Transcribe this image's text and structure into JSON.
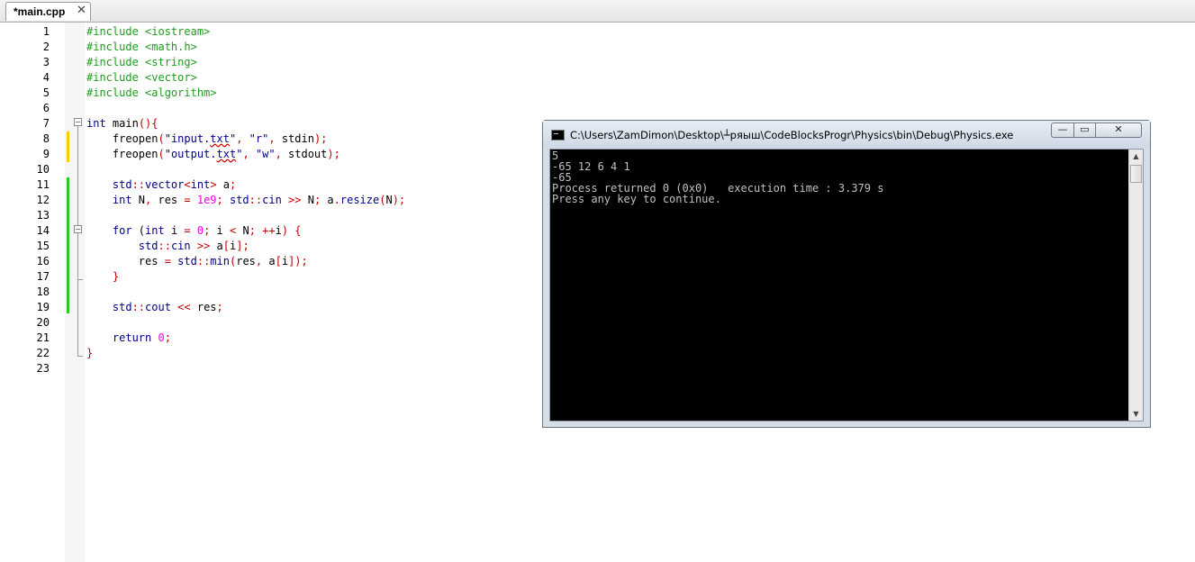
{
  "tab": {
    "title": "*main.cpp",
    "close_glyph": "✕"
  },
  "editor": {
    "line_numbers": [
      "1",
      "2",
      "3",
      "4",
      "5",
      "6",
      "7",
      "8",
      "9",
      "10",
      "11",
      "12",
      "13",
      "14",
      "15",
      "16",
      "17",
      "18",
      "19",
      "20",
      "21",
      "22",
      "23"
    ],
    "lines": [
      [
        {
          "t": "#include <iostream>",
          "c": "pp"
        }
      ],
      [
        {
          "t": "#include <math.h>",
          "c": "pp"
        }
      ],
      [
        {
          "t": "#include <string>",
          "c": "pp"
        }
      ],
      [
        {
          "t": "#include <vector>",
          "c": "pp"
        }
      ],
      [
        {
          "t": "#include <algorithm>",
          "c": "pp"
        }
      ],
      [],
      [
        {
          "t": "int",
          "c": "kw"
        },
        {
          "t": " main"
        },
        {
          "t": "(){",
          "c": "op"
        }
      ],
      [
        {
          "t": "    freopen"
        },
        {
          "t": "(",
          "c": "op"
        },
        {
          "t": "\"input.",
          "c": "str"
        },
        {
          "t": "txt",
          "c": "str sq"
        },
        {
          "t": "\"",
          "c": "str"
        },
        {
          "t": ", ",
          "c": "op"
        },
        {
          "t": "\"r\"",
          "c": "str"
        },
        {
          "t": ", ",
          "c": "op"
        },
        {
          "t": "stdin"
        },
        {
          "t": ");",
          "c": "op"
        }
      ],
      [
        {
          "t": "    freopen"
        },
        {
          "t": "(",
          "c": "op"
        },
        {
          "t": "\"output.",
          "c": "str"
        },
        {
          "t": "txt",
          "c": "str sq"
        },
        {
          "t": "\"",
          "c": "str"
        },
        {
          "t": ", ",
          "c": "op"
        },
        {
          "t": "\"w\"",
          "c": "str"
        },
        {
          "t": ", ",
          "c": "op"
        },
        {
          "t": "stdout"
        },
        {
          "t": ");",
          "c": "op"
        }
      ],
      [],
      [
        {
          "t": "    std",
          "c": "kw"
        },
        {
          "t": "::",
          "c": "op"
        },
        {
          "t": "vector",
          "c": "kw"
        },
        {
          "t": "<",
          "c": "op"
        },
        {
          "t": "int",
          "c": "kw"
        },
        {
          "t": ">",
          "c": "op"
        },
        {
          "t": " a"
        },
        {
          "t": ";",
          "c": "op"
        }
      ],
      [
        {
          "t": "    int",
          "c": "kw"
        },
        {
          "t": " N"
        },
        {
          "t": ", ",
          "c": "op"
        },
        {
          "t": "res "
        },
        {
          "t": "= ",
          "c": "op"
        },
        {
          "t": "1e9",
          "c": "num"
        },
        {
          "t": "; ",
          "c": "op"
        },
        {
          "t": "std",
          "c": "kw"
        },
        {
          "t": "::",
          "c": "op"
        },
        {
          "t": "cin",
          "c": "kw"
        },
        {
          "t": " >> ",
          "c": "op"
        },
        {
          "t": "N"
        },
        {
          "t": "; ",
          "c": "op"
        },
        {
          "t": "a"
        },
        {
          "t": ".",
          "c": "op"
        },
        {
          "t": "resize",
          "c": "kw"
        },
        {
          "t": "(",
          "c": "op"
        },
        {
          "t": "N"
        },
        {
          "t": ");",
          "c": "op"
        }
      ],
      [],
      [
        {
          "t": "    for",
          "c": "kw"
        },
        {
          "t": " ("
        },
        {
          "t": "int",
          "c": "kw"
        },
        {
          "t": " i "
        },
        {
          "t": "= ",
          "c": "op"
        },
        {
          "t": "0",
          "c": "num"
        },
        {
          "t": "; ",
          "c": "op"
        },
        {
          "t": "i "
        },
        {
          "t": "< ",
          "c": "op"
        },
        {
          "t": "N"
        },
        {
          "t": "; ++",
          "c": "op"
        },
        {
          "t": "i"
        },
        {
          "t": ") {",
          "c": "op"
        }
      ],
      [
        {
          "t": "        std",
          "c": "kw"
        },
        {
          "t": "::",
          "c": "op"
        },
        {
          "t": "cin",
          "c": "kw"
        },
        {
          "t": " >> ",
          "c": "op"
        },
        {
          "t": "a"
        },
        {
          "t": "[",
          "c": "op"
        },
        {
          "t": "i"
        },
        {
          "t": "];",
          "c": "op"
        }
      ],
      [
        {
          "t": "        res "
        },
        {
          "t": "= ",
          "c": "op"
        },
        {
          "t": "std",
          "c": "kw"
        },
        {
          "t": "::",
          "c": "op"
        },
        {
          "t": "min",
          "c": "kw"
        },
        {
          "t": "(",
          "c": "op"
        },
        {
          "t": "res"
        },
        {
          "t": ", ",
          "c": "op"
        },
        {
          "t": "a"
        },
        {
          "t": "[",
          "c": "op"
        },
        {
          "t": "i"
        },
        {
          "t": "]);",
          "c": "op"
        }
      ],
      [
        {
          "t": "    }",
          "c": "op"
        }
      ],
      [],
      [
        {
          "t": "    std",
          "c": "kw"
        },
        {
          "t": "::",
          "c": "op"
        },
        {
          "t": "cout",
          "c": "kw"
        },
        {
          "t": " << ",
          "c": "op"
        },
        {
          "t": "res"
        },
        {
          "t": ";",
          "c": "op"
        }
      ],
      [],
      [
        {
          "t": "    return",
          "c": "kw"
        },
        {
          "t": " "
        },
        {
          "t": "0",
          "c": "num"
        },
        {
          "t": ";",
          "c": "op"
        }
      ],
      [
        {
          "t": "}",
          "c": "op"
        }
      ],
      []
    ]
  },
  "console": {
    "title": "C:\\Users\\ZamDimon\\Desktop\\┴ряыш\\CodeBlocksProgr\\Physics\\bin\\Debug\\Physics.exe",
    "buttons": {
      "minimize": "—",
      "maximize": "▭",
      "close": "✕"
    },
    "output": [
      "5",
      "-65 12 6 4 1",
      "-65",
      "Process returned 0 (0x0)   execution time : 3.379 s",
      "Press any key to continue."
    ],
    "scroll_up": "▲",
    "scroll_down": "▼"
  },
  "icons": [
    "console-app-icon",
    "fold-minus-icon",
    "close-icon",
    "minimize-icon",
    "maximize-icon"
  ]
}
